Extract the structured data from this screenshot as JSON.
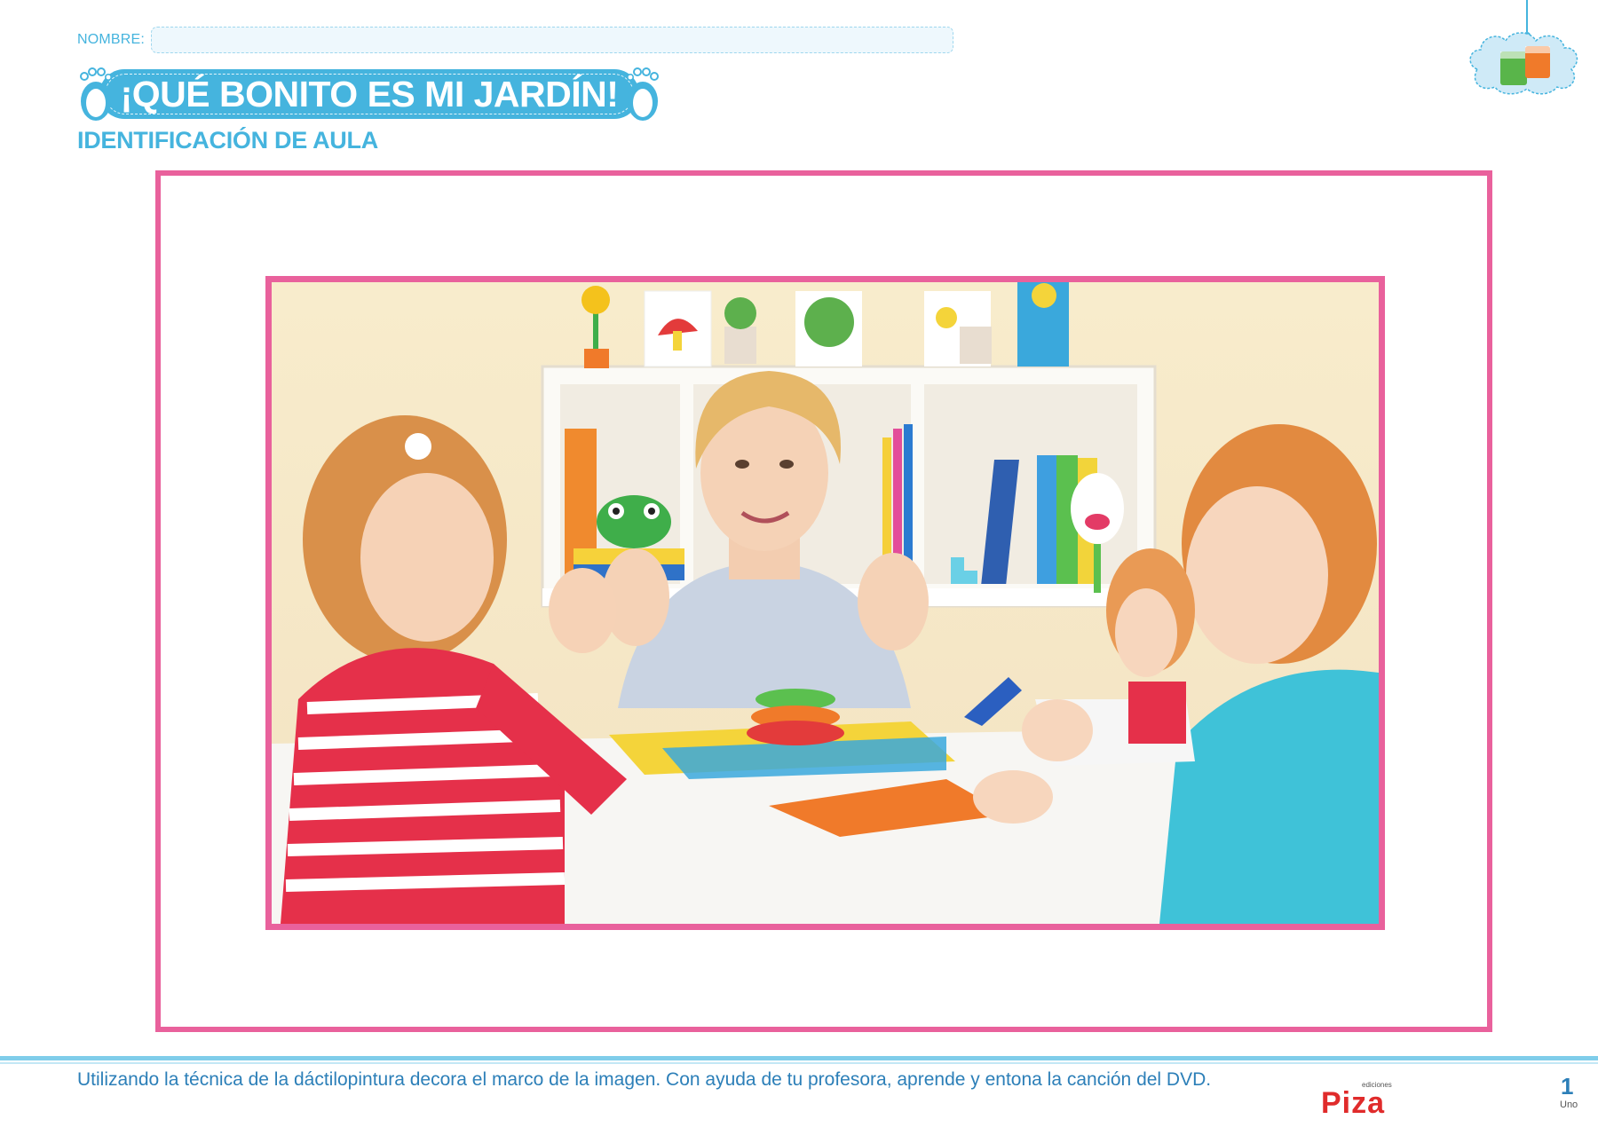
{
  "header": {
    "name_label": "NOMBRE:",
    "title": "¡QUÉ BONITO ES MI JARDÍN!",
    "subtitle": "IDENTIFICACIÓN DE AULA"
  },
  "photo": {
    "description_icon": "classroom-photo"
  },
  "footer": {
    "instruction": "Utilizando la técnica de la dáctilopintura decora el marco de la imagen. Con ayuda de tu profesora, aprende y entona la canción del DVD.",
    "publisher_small": "ediciones",
    "publisher": "Piza",
    "page_number": "1",
    "page_word": "Uno"
  },
  "colors": {
    "accent_blue": "#45b4de",
    "frame_pink": "#e9619c",
    "text_blue": "#2c7fb8",
    "brand_red": "#e02b2b"
  }
}
